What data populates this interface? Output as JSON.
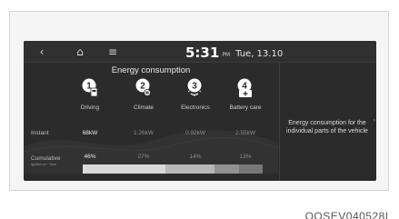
{
  "topbar": {
    "back_icon": "chevron-left-icon",
    "home_icon": "home-icon",
    "menu_icon": "menu-icon",
    "time": "5:31",
    "ampm": "PM",
    "date": "Tue, 13.10"
  },
  "panel": {
    "title": "Energy consumption",
    "columns": [
      {
        "number": "1",
        "label": "Driving",
        "icon": "driving-number-icon"
      },
      {
        "number": "2",
        "label": "Climate",
        "icon": "climate-number-icon"
      },
      {
        "number": "3",
        "label": "Electronics",
        "icon": "electronics-number-icon"
      },
      {
        "number": "4",
        "label": "Battery care",
        "icon": "battery-care-number-icon"
      }
    ],
    "instant": {
      "label": "Instant",
      "values": [
        "68kW",
        "1.26kW",
        "0.92kW",
        "2.55kW"
      ]
    },
    "cumulative": {
      "label": "Cumulative",
      "sublabel": "Ignition on ~ Now",
      "values": [
        "46%",
        "27%",
        "14%",
        "13%"
      ],
      "fractions": [
        0.46,
        0.27,
        0.14,
        0.13
      ],
      "colors": [
        "#d9d9d9",
        "#b8b8b8",
        "#929292",
        "#787878"
      ]
    }
  },
  "description": "Energy consumption for the individual parts of the vehicle",
  "caption": "OOSEV040528L"
}
